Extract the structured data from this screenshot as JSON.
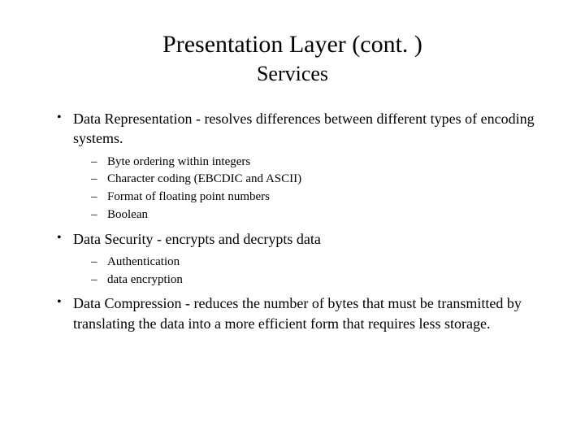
{
  "title": "Presentation Layer (cont. )",
  "subtitle": "Services",
  "items": [
    {
      "text": "Data Representation - resolves differences between different types of encoding systems.",
      "sub": [
        "Byte ordering within integers",
        "Character coding (EBCDIC and ASCII)",
        "Format of floating point numbers",
        "Boolean"
      ]
    },
    {
      "text": "Data Security - encrypts and decrypts data",
      "sub": [
        "Authentication",
        "data encryption"
      ]
    },
    {
      "text": "Data Compression - reduces the number of bytes that must be transmitted by translating the data into a more efficient form that requires less storage.",
      "sub": []
    }
  ]
}
